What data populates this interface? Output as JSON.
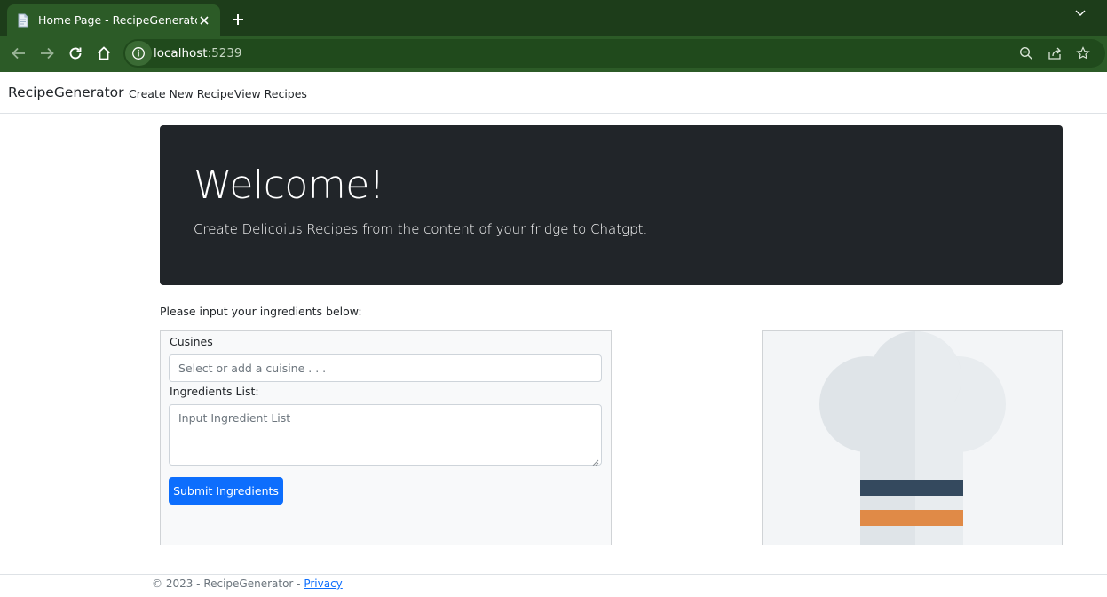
{
  "browser": {
    "tab_title": "Home Page - RecipeGenerator",
    "url_host": "localhost",
    "url_port": ":5239"
  },
  "navbar": {
    "brand": "RecipeGenerator",
    "links": [
      "Create New Recipe",
      "View Recipes"
    ]
  },
  "hero": {
    "heading": "Welcome!",
    "lead": "Create Delicoius Recipes from the content of your fridge to Chatgpt."
  },
  "form": {
    "intro": "Please input your ingredients below:",
    "cuisine_label": "Cusines",
    "cuisine_placeholder": "Select or add a cuisine . . .",
    "ingredients_label": "Ingredients List:",
    "ingredients_placeholder": "Input Ingredient List",
    "submit_label": "Submit Ingredients"
  },
  "footer": {
    "copyright": "© 2023 - RecipeGenerator - ",
    "privacy_link": "Privacy"
  },
  "colors": {
    "tab_strip": "#1d3d1a",
    "toolbar": "#2c5b27",
    "hero_bg": "#212529",
    "primary": "#0d6efd",
    "chef_hat": "#e1e6ea",
    "stripe_dark": "#34495e",
    "stripe_orange": "#e08a47"
  },
  "icons": {
    "tab_favicon": "document-icon",
    "tab_close": "close-icon",
    "new_tab": "plus-icon",
    "back": "arrow-left-icon",
    "forward": "arrow-right-icon",
    "reload": "reload-icon",
    "home": "home-icon",
    "site_info": "info-icon",
    "zoom": "zoom-icon",
    "share": "share-icon",
    "bookmark": "star-icon",
    "hero_image": "chef-hat-icon"
  }
}
